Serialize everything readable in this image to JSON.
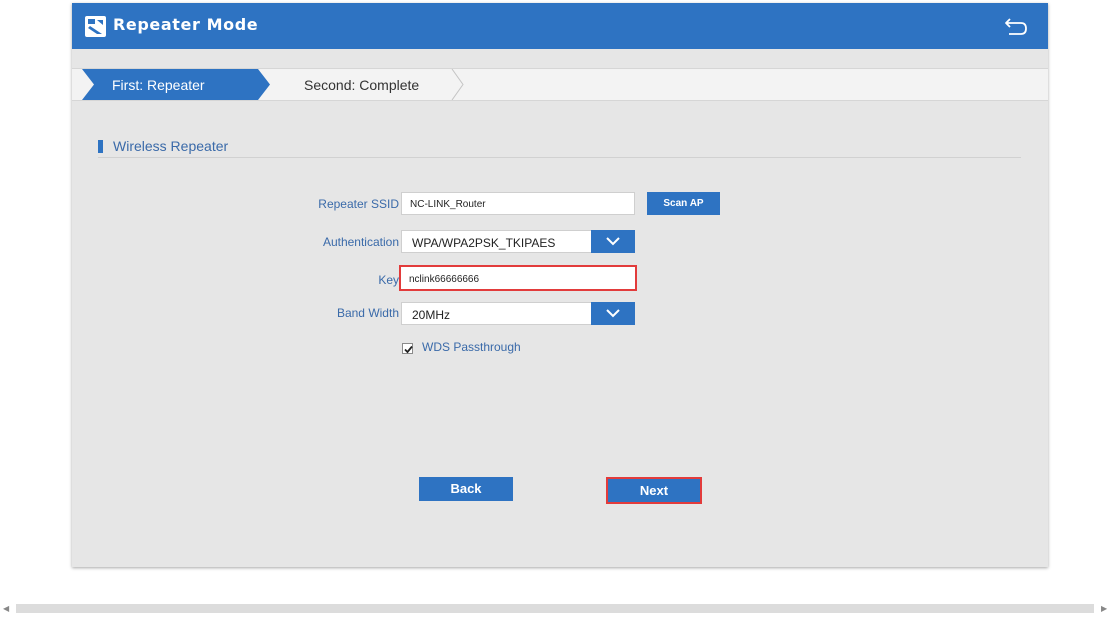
{
  "window": {
    "title": "Repeater Mode"
  },
  "steps": [
    {
      "label": "First: Repeater",
      "active": true
    },
    {
      "label": "Second: Complete",
      "active": false
    }
  ],
  "section": {
    "title": "Wireless Repeater"
  },
  "form": {
    "ssid_label": "Repeater SSID",
    "ssid_value": "NC-LINK_Router",
    "scan_label": "Scan AP",
    "auth_label": "Authentication",
    "auth_value": "WPA/WPA2PSK_TKIPAES",
    "key_label": "Key",
    "key_value": "nclink66666666",
    "bandwidth_label": "Band Width",
    "bandwidth_value": "20MHz",
    "wds_label": "WDS Passthrough",
    "wds_checked": true
  },
  "buttons": {
    "back_label": "Back",
    "next_label": "Next"
  },
  "colors": {
    "accent": "#2e73c2",
    "highlight": "#e23b3b",
    "panel": "#e6e6e6",
    "label": "#3a6aa9"
  },
  "icons": {
    "title": "app-logo-icon",
    "back": "return-arrow-icon",
    "dropdown": "chevron-down-icon",
    "checkbox": "checkmark-icon"
  }
}
